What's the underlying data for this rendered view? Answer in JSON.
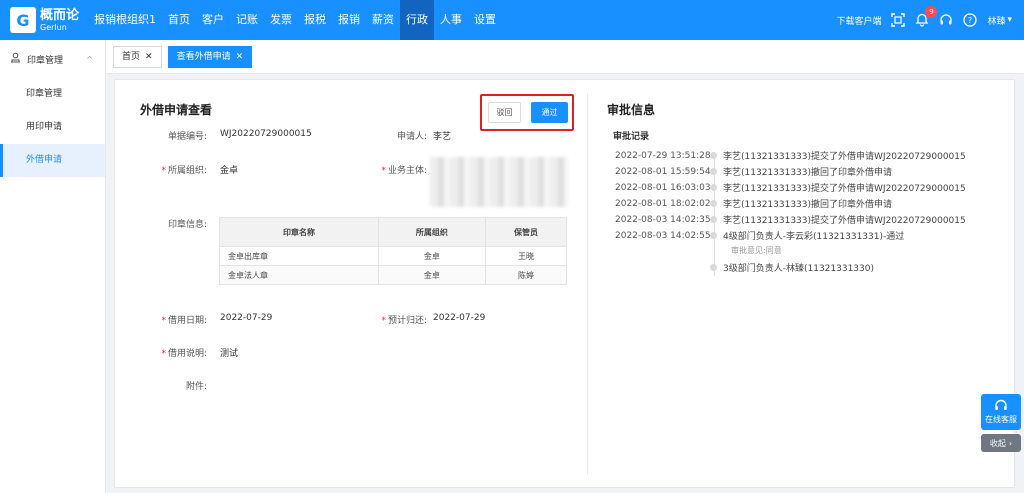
{
  "app": {
    "logo_cn": "概而论",
    "logo_en": "Gerlun",
    "nav": [
      "报销根组织1",
      "首页",
      "客户",
      "记账",
      "发票",
      "报税",
      "报销",
      "薪资",
      "行政",
      "人事",
      "设置"
    ],
    "nav_active": "行政",
    "download_client": "下载客户端",
    "notification_count": "9",
    "user_name": "林臻"
  },
  "sidebar": {
    "group_label": "印章管理",
    "items": [
      {
        "label": "印章管理",
        "active": false
      },
      {
        "label": "用印申请",
        "active": false
      },
      {
        "label": "外借申请",
        "active": true
      }
    ]
  },
  "tabs": [
    {
      "label": "首页",
      "active": false
    },
    {
      "label": "查看外借申请",
      "active": true
    }
  ],
  "detail": {
    "title": "外借申请查看",
    "buttons": {
      "reject": "驳回",
      "pass": "通过"
    },
    "fields": {
      "doc_no_label": "单据编号:",
      "doc_no": "WJ20220729000015",
      "applicant_label": "申请人:",
      "applicant": "李艺",
      "org_label": "所属组织:",
      "org": "金卓",
      "business_label": "业务主体:",
      "seal_info_label": "印章信息:",
      "borrow_date_label": "借用日期:",
      "borrow_date": "2022-07-29",
      "return_date_label": "预计归还:",
      "return_date": "2022-07-29",
      "desc_label": "借用说明:",
      "desc": "测试",
      "attachment_label": "附件:"
    },
    "seal_table": {
      "headers": [
        "印章名称",
        "所属组织",
        "保管员"
      ],
      "rows": [
        [
          "金卓出库章",
          "金卓",
          "王晓"
        ],
        [
          "金卓法人章",
          "金卓",
          "陈婷"
        ]
      ]
    }
  },
  "approval": {
    "title": "审批信息",
    "records_title": "审批记录",
    "records": [
      {
        "time": "2022-07-29 13:51:28",
        "text": "李艺(11321331333)提交了外借申请WJ20220729000015"
      },
      {
        "time": "2022-08-01 15:59:54",
        "text": "李艺(11321331333)撤回了印章外借申请"
      },
      {
        "time": "2022-08-01 16:03:03",
        "text": "李艺(11321331333)提交了外借申请WJ20220729000015"
      },
      {
        "time": "2022-08-01 18:02:02",
        "text": "李艺(11321331333)撤回了印章外借申请"
      },
      {
        "time": "2022-08-03 14:02:35",
        "text": "李艺(11321331333)提交了外借申请WJ20220729000015"
      },
      {
        "time": "2022-08-03 14:02:55",
        "text": "4级部门负责人-李云彩(11321331331)-通过"
      }
    ],
    "opinion": "审批意见:同意",
    "pending": "3级部门负责人-林臻(11321331330)"
  },
  "float": {
    "service_label": "在线客服",
    "collapse_label": "收起"
  }
}
